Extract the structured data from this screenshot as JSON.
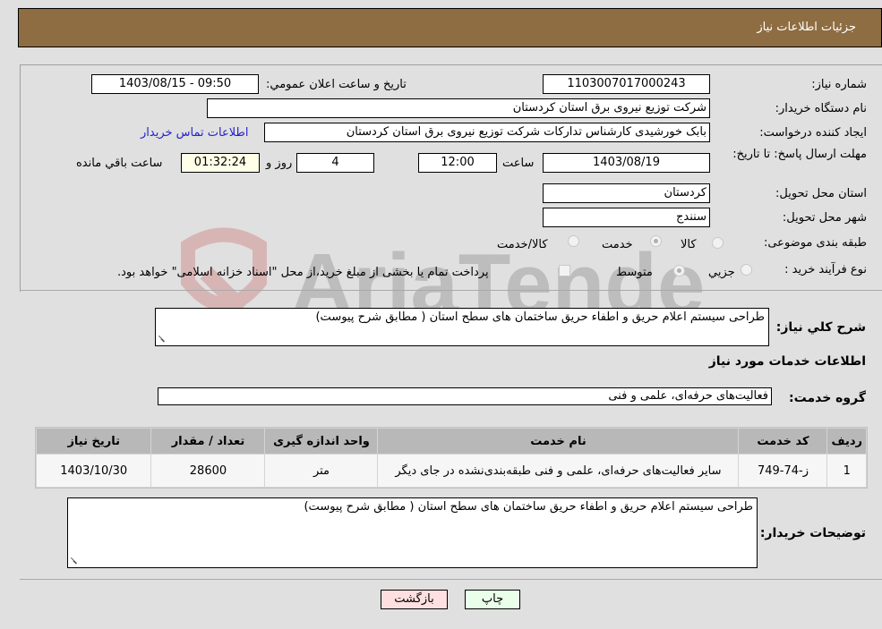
{
  "header": {
    "title": "جزئیات اطلاعات نیاز"
  },
  "form": {
    "need_number_label": "شماره نیاز:",
    "need_number": "1103007017000243",
    "announce_label": "تاریخ و ساعت اعلان عمومي:",
    "announce_value": "1403/08/15 - 09:50",
    "buyer_org_label": "نام دستگاه خریدار:",
    "buyer_org": "شرکت توزیع نیروی برق استان کردستان",
    "creator_label": "ایجاد کننده درخواست:",
    "creator": "بابک خورشیدی کارشناس تدارکات شرکت توزیع نیروی برق استان کردستان",
    "contact_link": "اطلاعات تماس خریدار",
    "deadline_label": "مهلت ارسال پاسخ: تا تاریخ:",
    "deadline_date": "1403/08/19",
    "time_label": "ساعت",
    "deadline_time": "12:00",
    "days": "4",
    "days_label": "روز و",
    "remaining_time": "01:32:24",
    "remaining_label": "ساعت باقي مانده",
    "province_label": "استان محل تحویل:",
    "province": "کردستان",
    "city_label": "شهر محل تحویل:",
    "city": "سنندج",
    "category_label": "طبقه بندی موضوعی:",
    "category_options": [
      {
        "label": "کالا",
        "checked": false
      },
      {
        "label": "خدمت",
        "checked": true
      },
      {
        "label": "کالا/خدمت",
        "checked": false
      }
    ],
    "process_label": "نوع فرآیند خرید :",
    "process_options": [
      {
        "label": "جزيي",
        "checked": false
      },
      {
        "label": "متوسط",
        "checked": true
      }
    ],
    "treasury_note": "پرداخت تمام یا بخشی از مبلغ خرید،از محل \"اسناد خزانه اسلامی\" خواهد بود.",
    "treasury_checked": false
  },
  "description": {
    "label": "شرح كلي نياز:",
    "value": "طراحی سیستم اعلام حریق و اطفاء حریق ساختمان های سطح استان ( مطابق شرح پیوست)"
  },
  "services": {
    "section_title": "اطلاعات خدمات مورد نياز",
    "group_label": "گروه خدمت:",
    "group_value": "فعالیت‌های حرفه‌ای، علمی و فنی",
    "columns": [
      "ردیف",
      "کد خدمت",
      "نام خدمت",
      "واحد اندازه گیری",
      "تعداد / مقدار",
      "تاریخ نیاز"
    ],
    "rows": [
      {
        "index": "1",
        "code": "ز-74-749",
        "name": "سایر فعالیت‌های حرفه‌ای، علمی و فنی طبقه‌بندی‌نشده در جای دیگر",
        "unit": "متر",
        "quantity": "28600",
        "date": "1403/10/30"
      }
    ]
  },
  "buyer_notes": {
    "label": "توضیحات خریدار:",
    "value": "طراحی سیستم اعلام حریق و اطفاء حریق ساختمان های سطح استان ( مطابق شرح پیوست)"
  },
  "buttons": {
    "print": "چاپ",
    "back": "بازگشت"
  },
  "watermark": {
    "text": "AriaTender.neT"
  },
  "colors": {
    "header_bg": "#8e6d42",
    "print_btn": "#eaffea",
    "back_btn": "#ffe0e0",
    "link": "#2222cc"
  }
}
